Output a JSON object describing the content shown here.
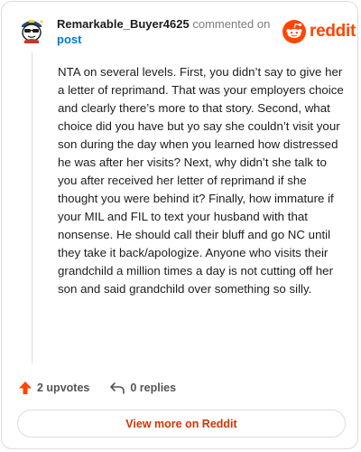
{
  "header": {
    "username": "Remarkable_Buyer4625",
    "commented_text": "commented on",
    "post_link": "post"
  },
  "brand": {
    "wordmark": "reddit",
    "icon": "reddit-logo-icon",
    "color": "#ff4500"
  },
  "comment": {
    "body": "NTA on several levels. First, you didn’t say to give her a letter of reprimand. That was your employers choice and clearly there’s more to that story. Second, what choice did you have but yo say she couldn’t visit your son during the day when you learned how distressed he was after her visits? Next, why didn’t she talk to you after received her letter of reprimand if she thought you were behind it? Finally, how immature if your MIL and FIL to text your husband with that nonsense. He should call their bluff and go NC until they take it back/apologize. Anyone who visits their grandchild a million times a day is not cutting off her son and said grandchild over something so silly."
  },
  "actions": {
    "upvotes": "2 upvotes",
    "upvote_icon": "upvote-arrow-icon",
    "replies": "0 replies",
    "reply_icon": "reply-arrow-icon"
  },
  "footer": {
    "view_more": "View more on Reddit"
  }
}
